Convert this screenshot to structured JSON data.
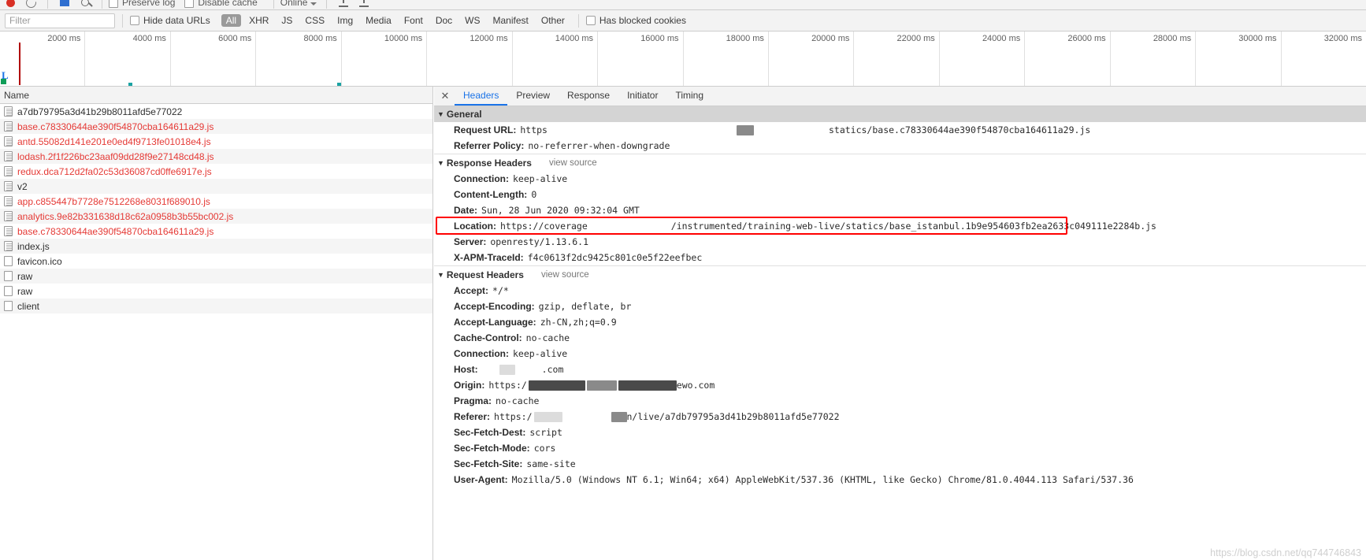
{
  "toolbar": {
    "record_icon": "record-dot-icon",
    "clear_icon": "clear-icon",
    "filter_icon": "filter-funnel-icon",
    "search_icon": "search-icon",
    "preserve_log_label": "Preserve log",
    "disable_cache_label": "Disable cache",
    "throttle_label": "Online",
    "import_icon": "import-har-icon",
    "export_icon": "export-har-icon"
  },
  "filterbar": {
    "filter_placeholder": "Filter",
    "hide_data_urls_label": "Hide data URLs",
    "has_blocked_cookies_label": "Has blocked cookies",
    "types": [
      {
        "label": "All",
        "active": true
      },
      {
        "label": "XHR",
        "active": false
      },
      {
        "label": "JS",
        "active": false
      },
      {
        "label": "CSS",
        "active": false
      },
      {
        "label": "Img",
        "active": false
      },
      {
        "label": "Media",
        "active": false
      },
      {
        "label": "Font",
        "active": false
      },
      {
        "label": "Doc",
        "active": false
      },
      {
        "label": "WS",
        "active": false
      },
      {
        "label": "Manifest",
        "active": false
      },
      {
        "label": "Other",
        "active": false
      }
    ]
  },
  "overview": {
    "ticks": [
      "2000 ms",
      "4000 ms",
      "6000 ms",
      "8000 ms",
      "10000 ms",
      "12000 ms",
      "14000 ms",
      "16000 ms",
      "18000 ms",
      "20000 ms",
      "22000 ms",
      "24000 ms",
      "26000 ms",
      "28000 ms",
      "30000 ms",
      "32000 ms"
    ],
    "dcl_marker_color": "#1a73e8",
    "load_marker_color": "#b00000",
    "onload_color": "#0f9d58"
  },
  "requests": {
    "column_header": "Name",
    "rows": [
      {
        "name": "a7db79795a3d41b29b8011afd5e77022",
        "status": "ok",
        "icon": "document-icon"
      },
      {
        "name": "base.c78330644ae390f54870cba164611a29.js",
        "status": "error",
        "icon": "document-icon"
      },
      {
        "name": "antd.55082d141e201e0ed4f9713fe01018e4.js",
        "status": "error",
        "icon": "document-icon"
      },
      {
        "name": "lodash.2f1f226bc23aaf09dd28f9e27148cd48.js",
        "status": "error",
        "icon": "document-icon"
      },
      {
        "name": "redux.dca712d2fa02c53d36087cd0ffe6917e.js",
        "status": "error",
        "icon": "document-icon"
      },
      {
        "name": "v2",
        "status": "ok",
        "icon": "document-icon"
      },
      {
        "name": "app.c855447b7728e7512268e8031f689010.js",
        "status": "error",
        "icon": "document-icon"
      },
      {
        "name": "analytics.9e82b331638d18c62a0958b3b55bc002.js",
        "status": "error",
        "icon": "document-icon"
      },
      {
        "name": "base.c78330644ae390f54870cba164611a29.js",
        "status": "error",
        "icon": "document-icon"
      },
      {
        "name": "index.js",
        "status": "ok",
        "icon": "document-icon"
      },
      {
        "name": "favicon.ico",
        "status": "ok",
        "icon": "generic-file-icon"
      },
      {
        "name": "raw",
        "status": "ok",
        "icon": "generic-file-icon"
      },
      {
        "name": "raw",
        "status": "ok",
        "icon": "generic-file-icon"
      },
      {
        "name": "client",
        "status": "ok",
        "icon": "generic-file-icon"
      }
    ]
  },
  "detail": {
    "close_icon": "close-icon",
    "tabs": [
      {
        "label": "Headers",
        "active": true
      },
      {
        "label": "Preview",
        "active": false
      },
      {
        "label": "Response",
        "active": false
      },
      {
        "label": "Initiator",
        "active": false
      },
      {
        "label": "Timing",
        "active": false
      }
    ],
    "sections": {
      "general": {
        "title": "General",
        "rows": [
          {
            "key": "Request URL:",
            "value_prefix": "https",
            "redacted": true,
            "value_suffix": "statics/base.c78330644ae390f54870cba164611a29.js"
          },
          {
            "key": "Referrer Policy:",
            "value": "no-referrer-when-downgrade"
          }
        ]
      },
      "response_headers": {
        "title": "Response Headers",
        "view_source": "view source",
        "rows": [
          {
            "key": "Connection:",
            "value": "keep-alive"
          },
          {
            "key": "Content-Length:",
            "value": "0"
          },
          {
            "key": "Date:",
            "value": "Sun, 28 Jun 2020 09:32:04 GMT"
          },
          {
            "key": "Location:",
            "value_prefix": "https://coverage",
            "redacted": true,
            "value_suffix": "/instrumented/training-web-live/statics/base_istanbul.1b9e954603fb2ea2633c049111e2284b.js",
            "highlighted": true
          },
          {
            "key": "Server:",
            "value": "openresty/1.13.6.1"
          },
          {
            "key": "X-APM-TraceId:",
            "value": "f4c0613f2dc9425c801c0e5f22eefbec"
          }
        ]
      },
      "request_headers": {
        "title": "Request Headers",
        "view_source": "view source",
        "rows": [
          {
            "key": "Accept:",
            "value": "*/*"
          },
          {
            "key": "Accept-Encoding:",
            "value": "gzip, deflate, br"
          },
          {
            "key": "Accept-Language:",
            "value": "zh-CN,zh;q=0.9"
          },
          {
            "key": "Cache-Control:",
            "value": "no-cache"
          },
          {
            "key": "Connection:",
            "value": "keep-alive"
          },
          {
            "key": "Host:",
            "value_prefix": "",
            "redacted": true,
            "value_suffix": ".com"
          },
          {
            "key": "Origin:",
            "value_prefix": "https:/",
            "redacted": true,
            "value_suffix": "ewo.com"
          },
          {
            "key": "Pragma:",
            "value": "no-cache"
          },
          {
            "key": "Referer:",
            "value_prefix": "https:/",
            "redacted": true,
            "value_suffix": "n/live/a7db79795a3d41b29b8011afd5e77022"
          },
          {
            "key": "Sec-Fetch-Dest:",
            "value": "script"
          },
          {
            "key": "Sec-Fetch-Mode:",
            "value": "cors"
          },
          {
            "key": "Sec-Fetch-Site:",
            "value": "same-site"
          },
          {
            "key": "User-Agent:",
            "value": "Mozilla/5.0 (Windows NT 6.1; Win64; x64) AppleWebKit/537.36 (KHTML, like Gecko) Chrome/81.0.4044.113 Safari/537.36"
          }
        ]
      }
    }
  },
  "watermark": "https://blog.csdn.net/qq744746843"
}
